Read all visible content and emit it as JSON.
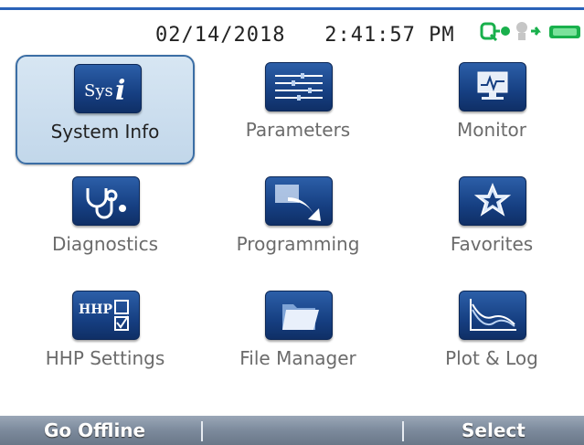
{
  "header": {
    "date": "02/14/2018",
    "time": "2:41:57 PM"
  },
  "status_icons": [
    "network-icon",
    "bluetooth-icon",
    "battery-icon"
  ],
  "tiles": [
    {
      "label": "System Info",
      "icon": "system-info-icon",
      "selected": true
    },
    {
      "label": "Parameters",
      "icon": "parameters-icon",
      "selected": false
    },
    {
      "label": "Monitor",
      "icon": "monitor-icon",
      "selected": false
    },
    {
      "label": "Diagnostics",
      "icon": "diagnostics-icon",
      "selected": false
    },
    {
      "label": "Programming",
      "icon": "programming-icon",
      "selected": false
    },
    {
      "label": "Favorites",
      "icon": "favorites-icon",
      "selected": false
    },
    {
      "label": "HHP Settings",
      "icon": "hhp-settings-icon",
      "selected": false
    },
    {
      "label": "File Manager",
      "icon": "file-manager-icon",
      "selected": false
    },
    {
      "label": "Plot & Log",
      "icon": "plot-log-icon",
      "selected": false
    }
  ],
  "softkeys": {
    "left": "Go Offline",
    "middle": "",
    "right": "Select"
  },
  "colors": {
    "accent": "#2a62b8",
    "icon_fill": "#1a468c",
    "selected_bg": "#c8dcec"
  }
}
